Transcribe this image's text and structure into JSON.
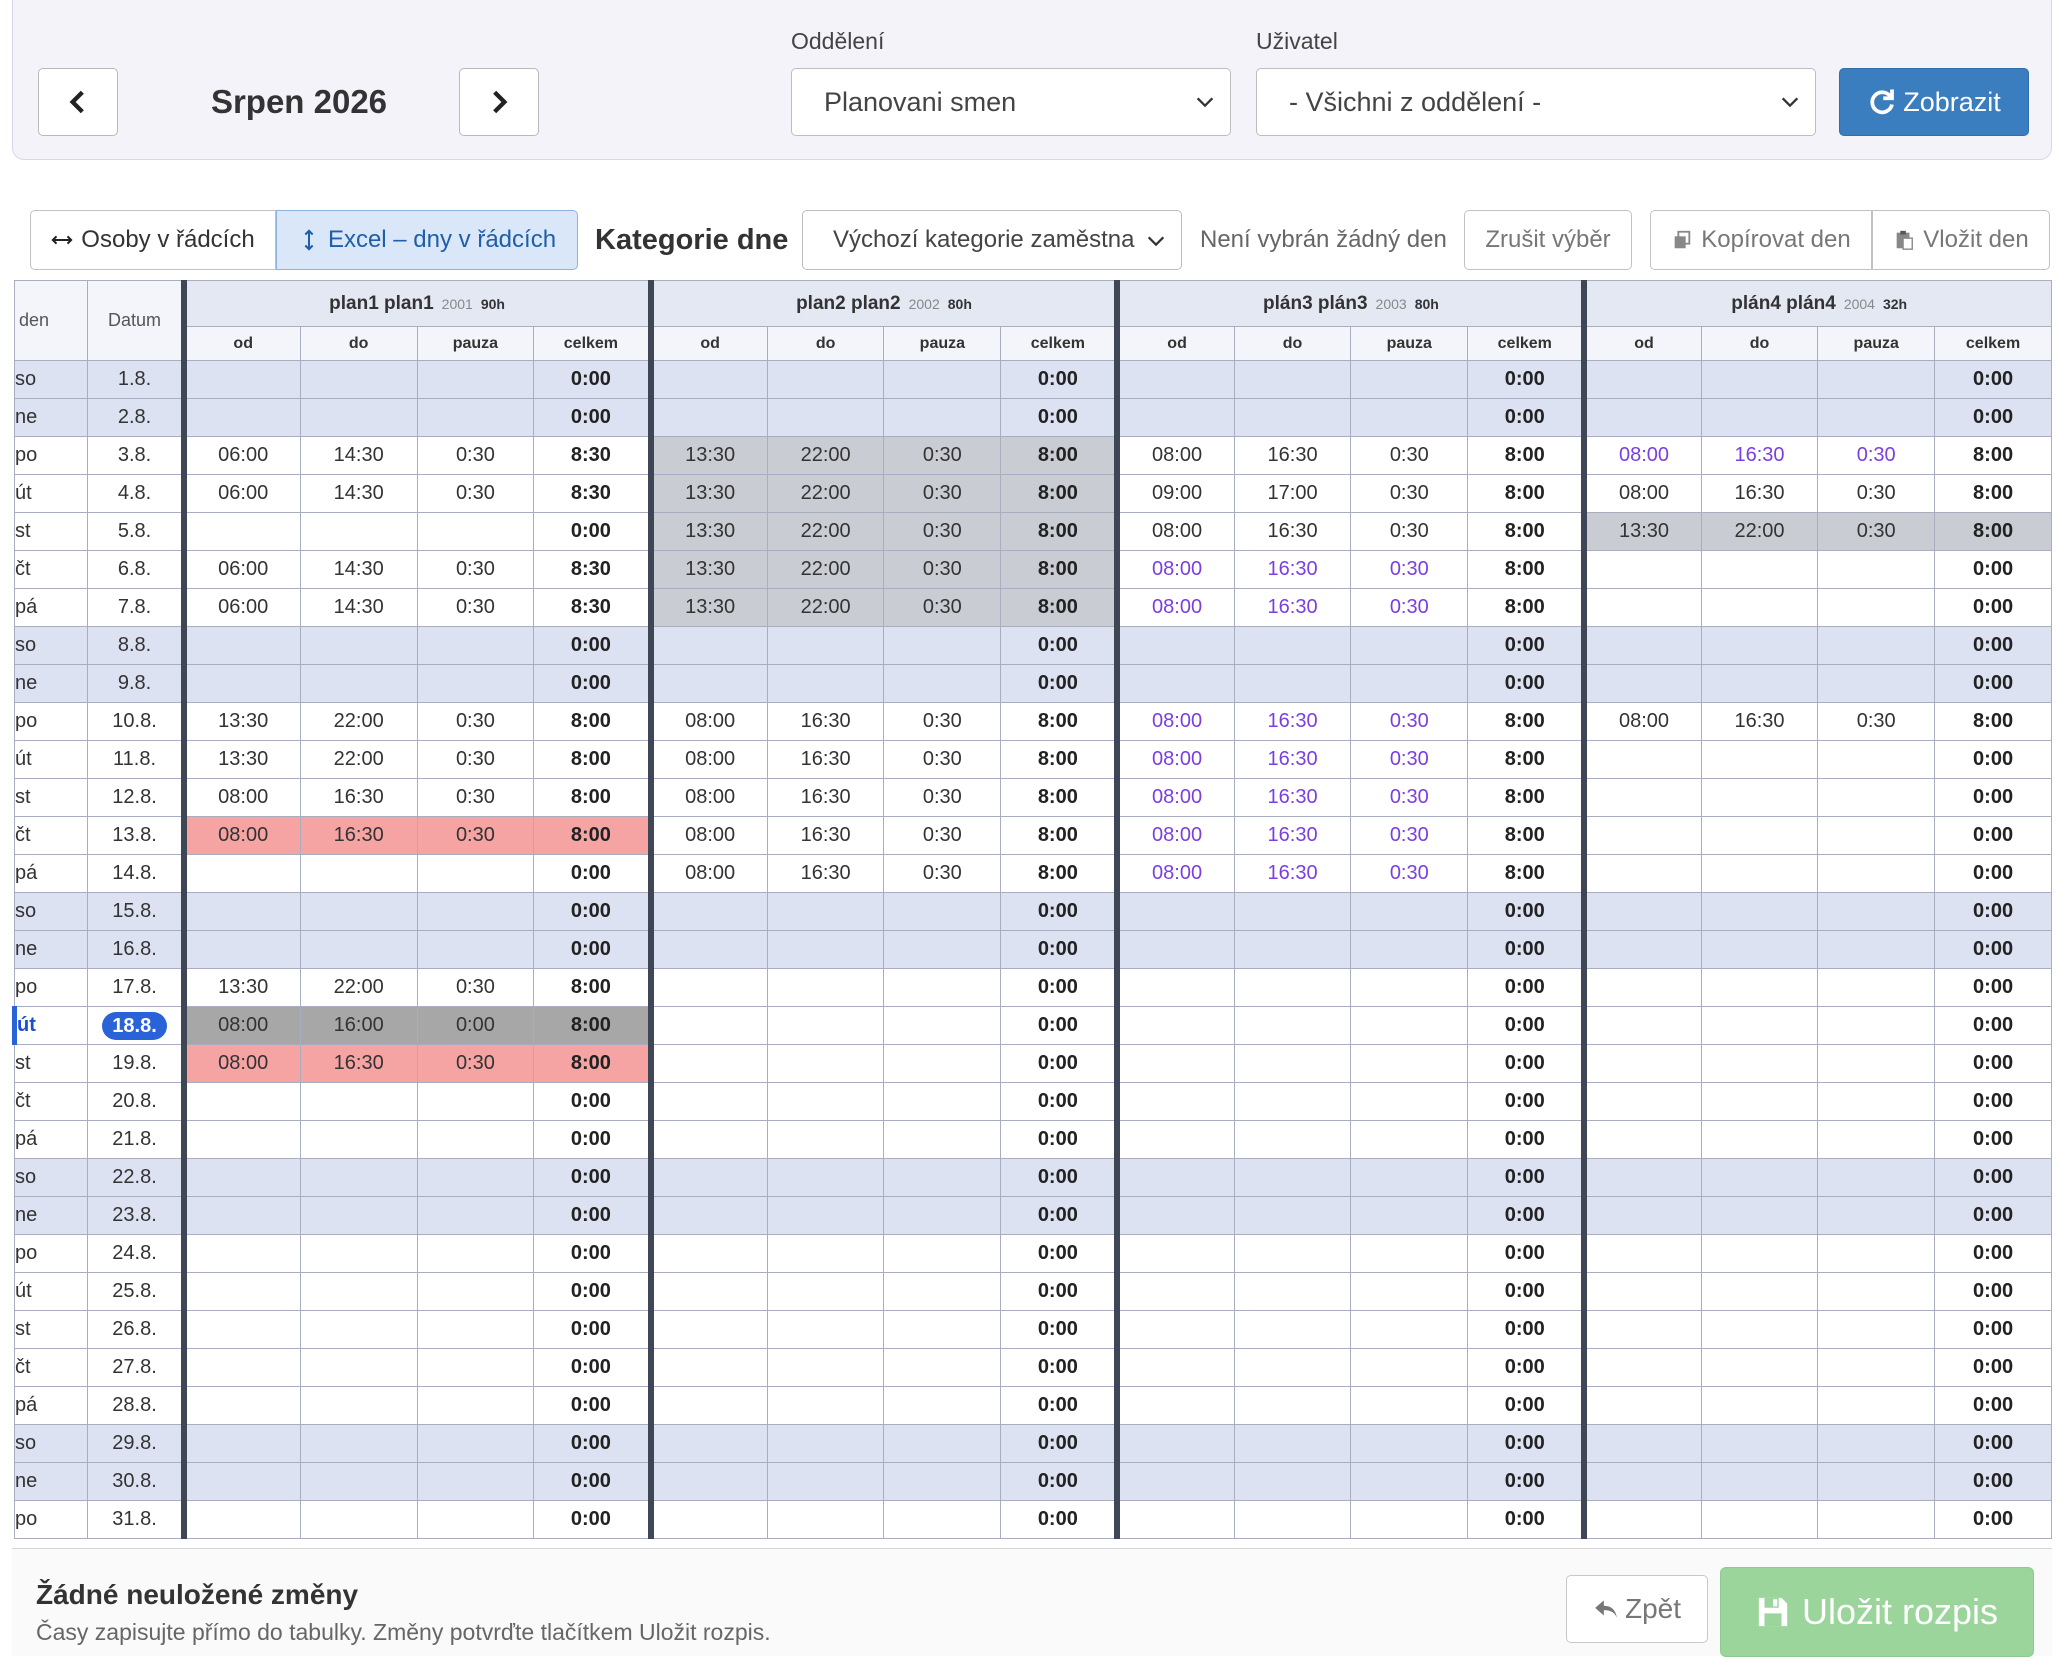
{
  "header": {
    "month": "Srpen 2026",
    "department_label": "Oddělení",
    "department_value": "Planovani smen",
    "user_label": "Uživatel",
    "user_value": "- Všichni z oddělení -",
    "show_button": "Zobrazit"
  },
  "toolbar": {
    "people_rows": "Osoby v řádcích",
    "excel_rows": "Excel – dny v řádcích",
    "category_label": "Kategorie dne",
    "category_value": "Výchozí kategorie zaměstna",
    "no_day": "Není vybrán žádný den",
    "clear": "Zrušit výběr",
    "copy": "Kopírovat den",
    "paste": "Vložit den"
  },
  "table": {
    "col_den": "den",
    "col_datum": "Datum",
    "sub_headers": [
      "od",
      "do",
      "pauza",
      "celkem"
    ],
    "people": [
      {
        "name": "plan1 plan1",
        "id": "2001",
        "hours": "90h"
      },
      {
        "name": "plan2 plan2",
        "id": "2002",
        "hours": "80h"
      },
      {
        "name": "plán3 plán3",
        "id": "2003",
        "hours": "80h"
      },
      {
        "name": "plán4 plán4",
        "id": "2004",
        "hours": "32h"
      }
    ],
    "rows": [
      {
        "den": "so",
        "datum": "1.8.",
        "weekend": true,
        "cells": [
          [
            "",
            "",
            "",
            "0:00"
          ],
          [
            "",
            "",
            "",
            "0:00"
          ],
          [
            "",
            "",
            "",
            "0:00"
          ],
          [
            "",
            "",
            "",
            "0:00"
          ]
        ]
      },
      {
        "den": "ne",
        "datum": "2.8.",
        "weekend": true,
        "cells": [
          [
            "",
            "",
            "",
            "0:00"
          ],
          [
            "",
            "",
            "",
            "0:00"
          ],
          [
            "",
            "",
            "",
            "0:00"
          ],
          [
            "",
            "",
            "",
            "0:00"
          ]
        ]
      },
      {
        "den": "po",
        "datum": "3.8.",
        "cells": [
          [
            "06:00",
            "14:30",
            "0:30",
            "8:30"
          ],
          [
            "13:30",
            "22:00",
            "0:30",
            "8:00",
            "gray"
          ],
          [
            "08:00",
            "16:30",
            "0:30",
            "8:00"
          ],
          [
            "08:00",
            "16:30",
            "0:30",
            "8:00",
            "purple"
          ]
        ]
      },
      {
        "den": "út",
        "datum": "4.8.",
        "cells": [
          [
            "06:00",
            "14:30",
            "0:30",
            "8:30"
          ],
          [
            "13:30",
            "22:00",
            "0:30",
            "8:00",
            "gray"
          ],
          [
            "09:00",
            "17:00",
            "0:30",
            "8:00"
          ],
          [
            "08:00",
            "16:30",
            "0:30",
            "8:00"
          ]
        ]
      },
      {
        "den": "st",
        "datum": "5.8.",
        "cells": [
          [
            "",
            "",
            "",
            "0:00"
          ],
          [
            "13:30",
            "22:00",
            "0:30",
            "8:00",
            "gray"
          ],
          [
            "08:00",
            "16:30",
            "0:30",
            "8:00"
          ],
          [
            "13:30",
            "22:00",
            "0:30",
            "8:00",
            "gray"
          ]
        ]
      },
      {
        "den": "čt",
        "datum": "6.8.",
        "cells": [
          [
            "06:00",
            "14:30",
            "0:30",
            "8:30"
          ],
          [
            "13:30",
            "22:00",
            "0:30",
            "8:00",
            "gray"
          ],
          [
            "08:00",
            "16:30",
            "0:30",
            "8:00",
            "purple"
          ],
          [
            "",
            "",
            "",
            "0:00"
          ]
        ]
      },
      {
        "den": "pá",
        "datum": "7.8.",
        "cells": [
          [
            "06:00",
            "14:30",
            "0:30",
            "8:30"
          ],
          [
            "13:30",
            "22:00",
            "0:30",
            "8:00",
            "gray"
          ],
          [
            "08:00",
            "16:30",
            "0:30",
            "8:00",
            "purple"
          ],
          [
            "",
            "",
            "",
            "0:00"
          ]
        ]
      },
      {
        "den": "so",
        "datum": "8.8.",
        "weekend": true,
        "cells": [
          [
            "",
            "",
            "",
            "0:00"
          ],
          [
            "",
            "",
            "",
            "0:00"
          ],
          [
            "",
            "",
            "",
            "0:00"
          ],
          [
            "",
            "",
            "",
            "0:00"
          ]
        ]
      },
      {
        "den": "ne",
        "datum": "9.8.",
        "weekend": true,
        "cells": [
          [
            "",
            "",
            "",
            "0:00"
          ],
          [
            "",
            "",
            "",
            "0:00"
          ],
          [
            "",
            "",
            "",
            "0:00"
          ],
          [
            "",
            "",
            "",
            "0:00"
          ]
        ]
      },
      {
        "den": "po",
        "datum": "10.8.",
        "cells": [
          [
            "13:30",
            "22:00",
            "0:30",
            "8:00"
          ],
          [
            "08:00",
            "16:30",
            "0:30",
            "8:00"
          ],
          [
            "08:00",
            "16:30",
            "0:30",
            "8:00",
            "purple"
          ],
          [
            "08:00",
            "16:30",
            "0:30",
            "8:00"
          ]
        ]
      },
      {
        "den": "út",
        "datum": "11.8.",
        "cells": [
          [
            "13:30",
            "22:00",
            "0:30",
            "8:00"
          ],
          [
            "08:00",
            "16:30",
            "0:30",
            "8:00"
          ],
          [
            "08:00",
            "16:30",
            "0:30",
            "8:00",
            "purple"
          ],
          [
            "",
            "",
            "",
            "0:00"
          ]
        ]
      },
      {
        "den": "st",
        "datum": "12.8.",
        "cells": [
          [
            "08:00",
            "16:30",
            "0:30",
            "8:00"
          ],
          [
            "08:00",
            "16:30",
            "0:30",
            "8:00"
          ],
          [
            "08:00",
            "16:30",
            "0:30",
            "8:00",
            "purple"
          ],
          [
            "",
            "",
            "",
            "0:00"
          ]
        ]
      },
      {
        "den": "čt",
        "datum": "13.8.",
        "cells": [
          [
            "08:00",
            "16:30",
            "0:30",
            "8:00",
            "red"
          ],
          [
            "08:00",
            "16:30",
            "0:30",
            "8:00"
          ],
          [
            "08:00",
            "16:30",
            "0:30",
            "8:00",
            "purple"
          ],
          [
            "",
            "",
            "",
            "0:00"
          ]
        ]
      },
      {
        "den": "pá",
        "datum": "14.8.",
        "cells": [
          [
            "",
            "",
            "",
            "0:00"
          ],
          [
            "08:00",
            "16:30",
            "0:30",
            "8:00"
          ],
          [
            "08:00",
            "16:30",
            "0:30",
            "8:00",
            "purple"
          ],
          [
            "",
            "",
            "",
            "0:00"
          ]
        ]
      },
      {
        "den": "so",
        "datum": "15.8.",
        "weekend": true,
        "cells": [
          [
            "",
            "",
            "",
            "0:00"
          ],
          [
            "",
            "",
            "",
            "0:00"
          ],
          [
            "",
            "",
            "",
            "0:00"
          ],
          [
            "",
            "",
            "",
            "0:00"
          ]
        ]
      },
      {
        "den": "ne",
        "datum": "16.8.",
        "weekend": true,
        "cells": [
          [
            "",
            "",
            "",
            "0:00"
          ],
          [
            "",
            "",
            "",
            "0:00"
          ],
          [
            "",
            "",
            "",
            "0:00"
          ],
          [
            "",
            "",
            "",
            "0:00"
          ]
        ]
      },
      {
        "den": "po",
        "datum": "17.8.",
        "cells": [
          [
            "13:30",
            "22:00",
            "0:30",
            "8:00"
          ],
          [
            "",
            "",
            "",
            "0:00"
          ],
          [
            "",
            "",
            "",
            "0:00"
          ],
          [
            "",
            "",
            "",
            "0:00"
          ]
        ]
      },
      {
        "den": "út",
        "datum": "18.8.",
        "today": true,
        "cells": [
          [
            "08:00",
            "16:00",
            "0:00",
            "8:00",
            "dgray"
          ],
          [
            "",
            "",
            "",
            "0:00"
          ],
          [
            "",
            "",
            "",
            "0:00"
          ],
          [
            "",
            "",
            "",
            "0:00"
          ]
        ]
      },
      {
        "den": "st",
        "datum": "19.8.",
        "cells": [
          [
            "08:00",
            "16:30",
            "0:30",
            "8:00",
            "red"
          ],
          [
            "",
            "",
            "",
            "0:00"
          ],
          [
            "",
            "",
            "",
            "0:00"
          ],
          [
            "",
            "",
            "",
            "0:00"
          ]
        ]
      },
      {
        "den": "čt",
        "datum": "20.8.",
        "cells": [
          [
            "",
            "",
            "",
            "0:00"
          ],
          [
            "",
            "",
            "",
            "0:00"
          ],
          [
            "",
            "",
            "",
            "0:00"
          ],
          [
            "",
            "",
            "",
            "0:00"
          ]
        ]
      },
      {
        "den": "pá",
        "datum": "21.8.",
        "cells": [
          [
            "",
            "",
            "",
            "0:00"
          ],
          [
            "",
            "",
            "",
            "0:00"
          ],
          [
            "",
            "",
            "",
            "0:00"
          ],
          [
            "",
            "",
            "",
            "0:00"
          ]
        ]
      },
      {
        "den": "so",
        "datum": "22.8.",
        "weekend": true,
        "cells": [
          [
            "",
            "",
            "",
            "0:00"
          ],
          [
            "",
            "",
            "",
            "0:00"
          ],
          [
            "",
            "",
            "",
            "0:00"
          ],
          [
            "",
            "",
            "",
            "0:00"
          ]
        ]
      },
      {
        "den": "ne",
        "datum": "23.8.",
        "weekend": true,
        "cells": [
          [
            "",
            "",
            "",
            "0:00"
          ],
          [
            "",
            "",
            "",
            "0:00"
          ],
          [
            "",
            "",
            "",
            "0:00"
          ],
          [
            "",
            "",
            "",
            "0:00"
          ]
        ]
      },
      {
        "den": "po",
        "datum": "24.8.",
        "cells": [
          [
            "",
            "",
            "",
            "0:00"
          ],
          [
            "",
            "",
            "",
            "0:00"
          ],
          [
            "",
            "",
            "",
            "0:00"
          ],
          [
            "",
            "",
            "",
            "0:00"
          ]
        ]
      },
      {
        "den": "út",
        "datum": "25.8.",
        "cells": [
          [
            "",
            "",
            "",
            "0:00"
          ],
          [
            "",
            "",
            "",
            "0:00"
          ],
          [
            "",
            "",
            "",
            "0:00"
          ],
          [
            "",
            "",
            "",
            "0:00"
          ]
        ]
      },
      {
        "den": "st",
        "datum": "26.8.",
        "cells": [
          [
            "",
            "",
            "",
            "0:00"
          ],
          [
            "",
            "",
            "",
            "0:00"
          ],
          [
            "",
            "",
            "",
            "0:00"
          ],
          [
            "",
            "",
            "",
            "0:00"
          ]
        ]
      },
      {
        "den": "čt",
        "datum": "27.8.",
        "cells": [
          [
            "",
            "",
            "",
            "0:00"
          ],
          [
            "",
            "",
            "",
            "0:00"
          ],
          [
            "",
            "",
            "",
            "0:00"
          ],
          [
            "",
            "",
            "",
            "0:00"
          ]
        ]
      },
      {
        "den": "pá",
        "datum": "28.8.",
        "cells": [
          [
            "",
            "",
            "",
            "0:00"
          ],
          [
            "",
            "",
            "",
            "0:00"
          ],
          [
            "",
            "",
            "",
            "0:00"
          ],
          [
            "",
            "",
            "",
            "0:00"
          ]
        ]
      },
      {
        "den": "so",
        "datum": "29.8.",
        "weekend": true,
        "cells": [
          [
            "",
            "",
            "",
            "0:00"
          ],
          [
            "",
            "",
            "",
            "0:00"
          ],
          [
            "",
            "",
            "",
            "0:00"
          ],
          [
            "",
            "",
            "",
            "0:00"
          ]
        ]
      },
      {
        "den": "ne",
        "datum": "30.8.",
        "weekend": true,
        "cells": [
          [
            "",
            "",
            "",
            "0:00"
          ],
          [
            "",
            "",
            "",
            "0:00"
          ],
          [
            "",
            "",
            "",
            "0:00"
          ],
          [
            "",
            "",
            "",
            "0:00"
          ]
        ]
      },
      {
        "den": "po",
        "datum": "31.8.",
        "cells": [
          [
            "",
            "",
            "",
            "0:00"
          ],
          [
            "",
            "",
            "",
            "0:00"
          ],
          [
            "",
            "",
            "",
            "0:00"
          ],
          [
            "",
            "",
            "",
            "0:00"
          ]
        ]
      }
    ]
  },
  "footer": {
    "status": "Žádné neuložené změny",
    "hint": "Časy zapisujte přímo do tabulky. Změny potvrďte tlačítkem Uložit rozpis.",
    "back": "Zpět",
    "save": "Uložit rozpis"
  },
  "colors": {
    "primary": "#3a7ec0",
    "weekend": "#dde2f3",
    "shift_gray": "#c9ccd3",
    "selected_gray": "#a7a7a7",
    "conflict_red": "#f5a3a3",
    "purple_text": "#7b3fe0",
    "save_green": "#9bd59c"
  }
}
